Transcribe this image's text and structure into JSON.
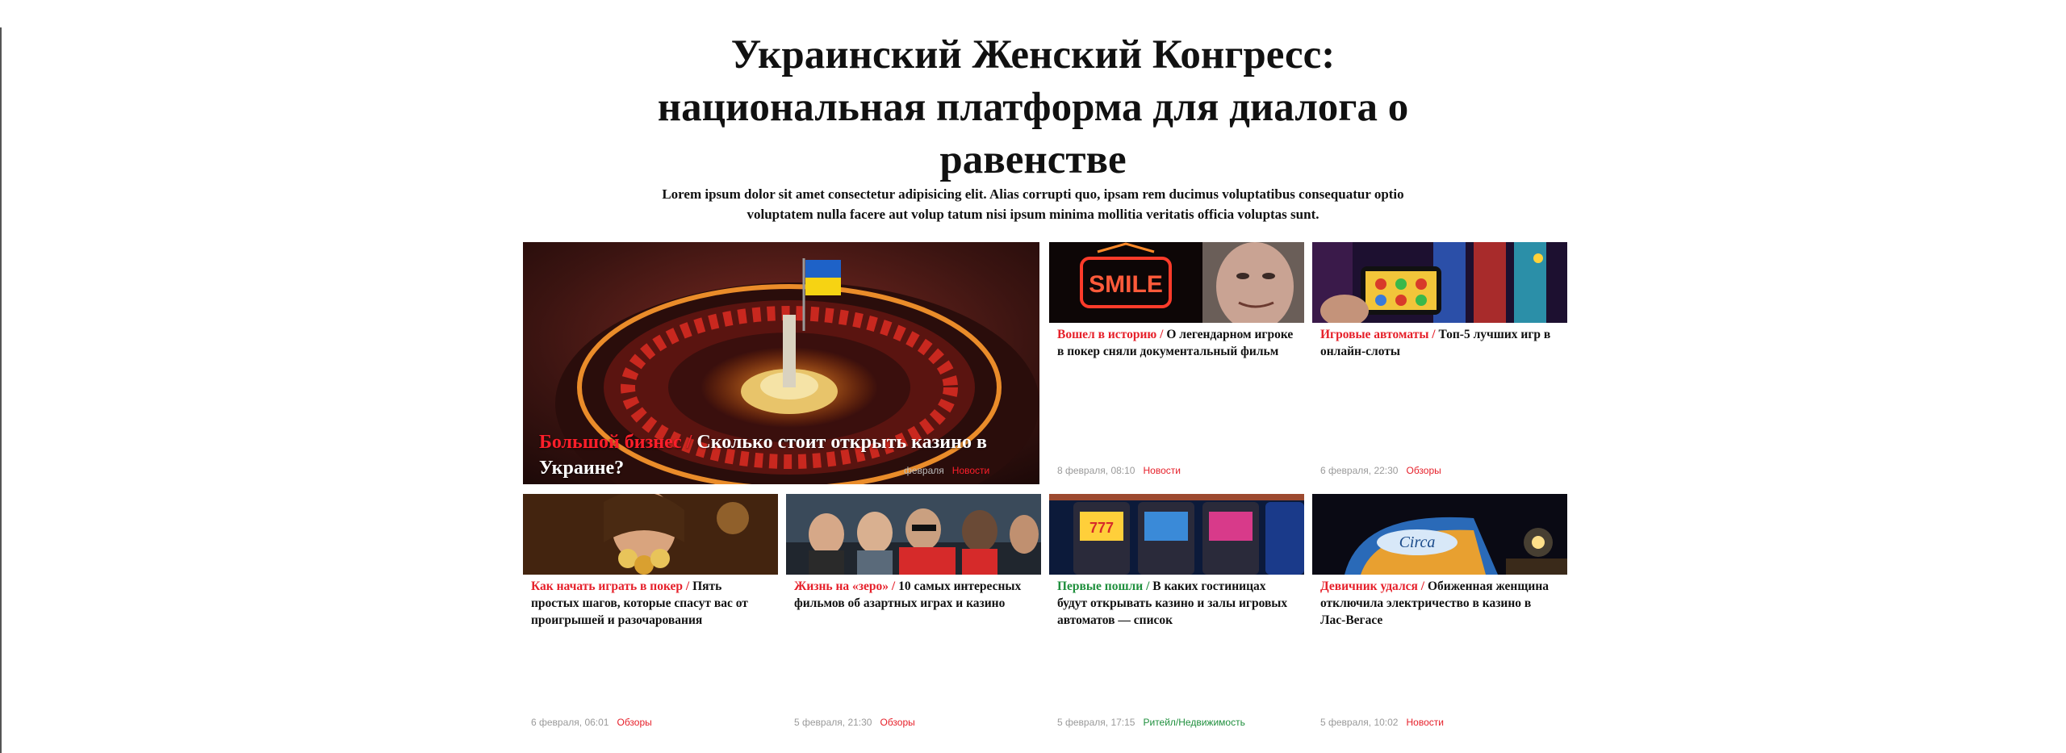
{
  "headline": "Украинский Женский Конгресс: национальная платформа для диалога о равенстве",
  "lead": "Lorem ipsum dolor sit amet consectetur adipisicing elit. Alias corrupti quo, ipsam rem ducimus voluptatibus consequatur optio voluptatem nulla facere aut volup tatum nisi ipsum minima mollitia veritatis officia voluptas sunt.",
  "colors": {
    "accent": "#e6202a",
    "green": "#1f8f3d",
    "meta": "#9a9a9a"
  },
  "hero": {
    "category": "Большой бизнес",
    "title": "Сколько стоит открыть казино в Украине?",
    "date": "февраля",
    "tag": "Новости",
    "image": "roulette-wheel-with-ukrainian-flag"
  },
  "cards": [
    {
      "category": "Вошел в историю",
      "title": "О легендарном игроке в покер сняли документальный фильм",
      "date": "8 февраля, 08:10",
      "tag": "Новости",
      "image": "neon-smile-sign-and-man"
    },
    {
      "category": "Игровые автоматы",
      "title": "Топ-5 лучших игр в онлайн-слоты",
      "date": "6 февраля, 22:30",
      "tag": "Обзоры",
      "image": "phone-slot-game-in-casino"
    },
    {
      "category": "Как начать играть в покер",
      "title": "Пять простых шагов, которые спасут вас от проигрышей и разочарования",
      "date": "6 февраля, 06:01",
      "tag": "Обзоры",
      "image": "woman-with-poker-chips"
    },
    {
      "category": "Жизнь на «зеро»",
      "title": "10 самых интересных фильмов об азартных играх и казино",
      "date": "5 февраля, 21:30",
      "tag": "Обзоры",
      "image": "movie-cast-group"
    },
    {
      "category": "Первые пошли",
      "title": "В каких гостиницах будут открывать казино и залы игровых автоматов — список",
      "date": "5 февраля, 17:15",
      "tag": "Ритейл/Недвижимость",
      "image": "slot-machines-hall"
    },
    {
      "category": "Девичник удался",
      "title": "Обиженная женщина отключила электричество в казино в Лас-Вегасе",
      "date": "5 февраля, 10:02",
      "tag": "Новости",
      "image": "circa-las-vegas-night"
    }
  ]
}
